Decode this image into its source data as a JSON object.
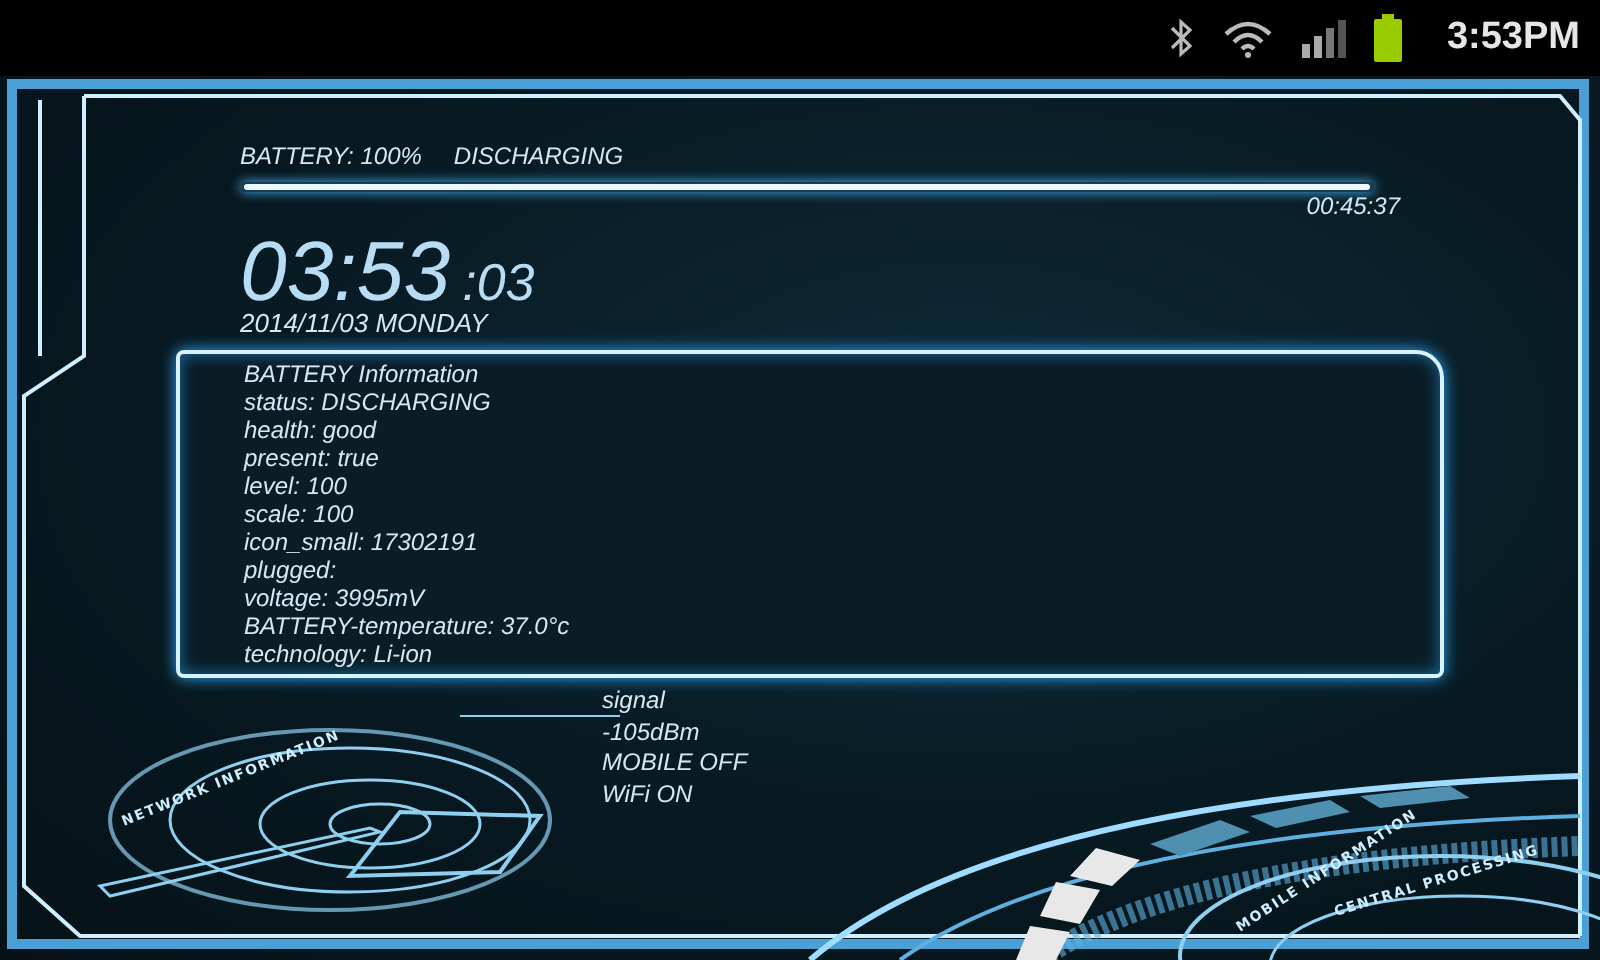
{
  "status_bar": {
    "time": "3:53PM"
  },
  "battery_header": {
    "percent_text": "BATTERY: 100%",
    "state_text": "DISCHARGING",
    "level": 1,
    "elapsed": "00:45:37"
  },
  "clock": {
    "time": "03:53",
    "seconds": ":03",
    "date": "2014/11/03  MONDAY"
  },
  "battery_info": {
    "lines": [
      "BATTERY Information",
      "status: DISCHARGING",
      "health: good",
      "present: true",
      "level: 100",
      "scale: 100",
      "icon_small: 17302191",
      "plugged:",
      "voltage: 3995mV",
      "BATTERY-temperature: 37.0°c",
      "technology: Li-ion"
    ]
  },
  "network": {
    "lines": [
      "signal",
      "-105dBm",
      "MOBILE OFF",
      "WiFi ON"
    ]
  },
  "artwork_labels": {
    "network_dial": "NETWORK INFORMATION",
    "mobile_dial": "MOBILE INFORMATION",
    "cpu_dial": "CENTRAL PROCESSING"
  }
}
